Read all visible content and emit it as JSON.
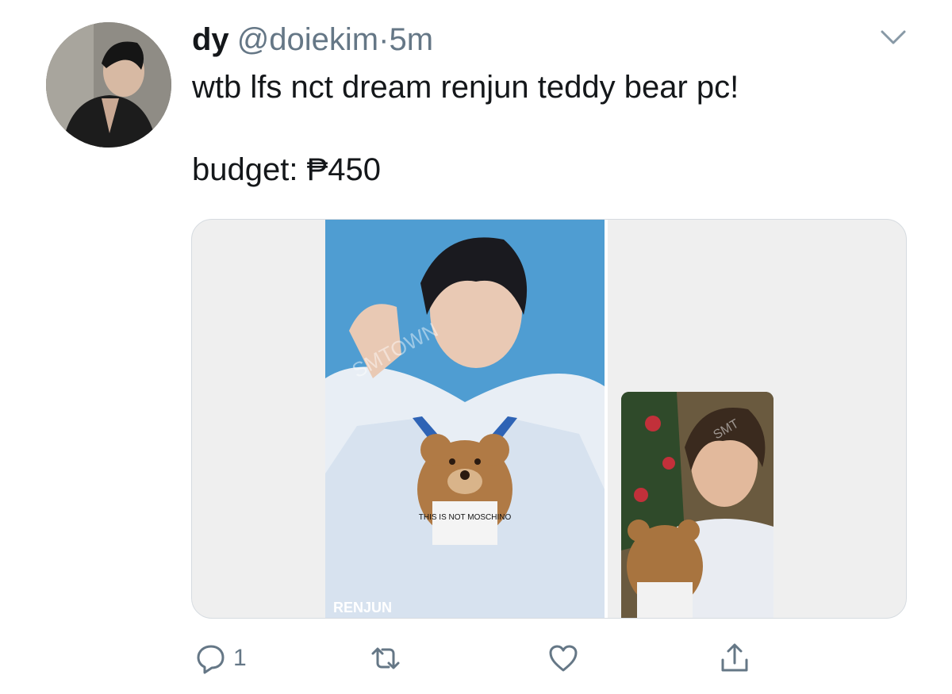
{
  "tweet": {
    "author": {
      "name": "dy",
      "handle": "@doiekim"
    },
    "separator": "·",
    "time": "5m",
    "text": "wtb lfs nct dream renjun teddy bear pc!\n\nbudget: ₱450",
    "media": {
      "main_photo": {
        "watermark": "SMTOWN",
        "label": "RENJUN",
        "bear_shirt": "THIS IS NOT MOSCHINO"
      },
      "card_photo": {
        "watermark": "SMT"
      }
    },
    "actions": {
      "reply_count": "1",
      "retweet_count": "",
      "like_count": "",
      "icons": [
        "reply-icon",
        "retweet-icon",
        "like-icon",
        "share-icon"
      ]
    }
  },
  "colors": {
    "text": "#14171a",
    "secondary": "#657786",
    "border": "#d6dbe0",
    "photo_blue": "#4f9dd2"
  }
}
